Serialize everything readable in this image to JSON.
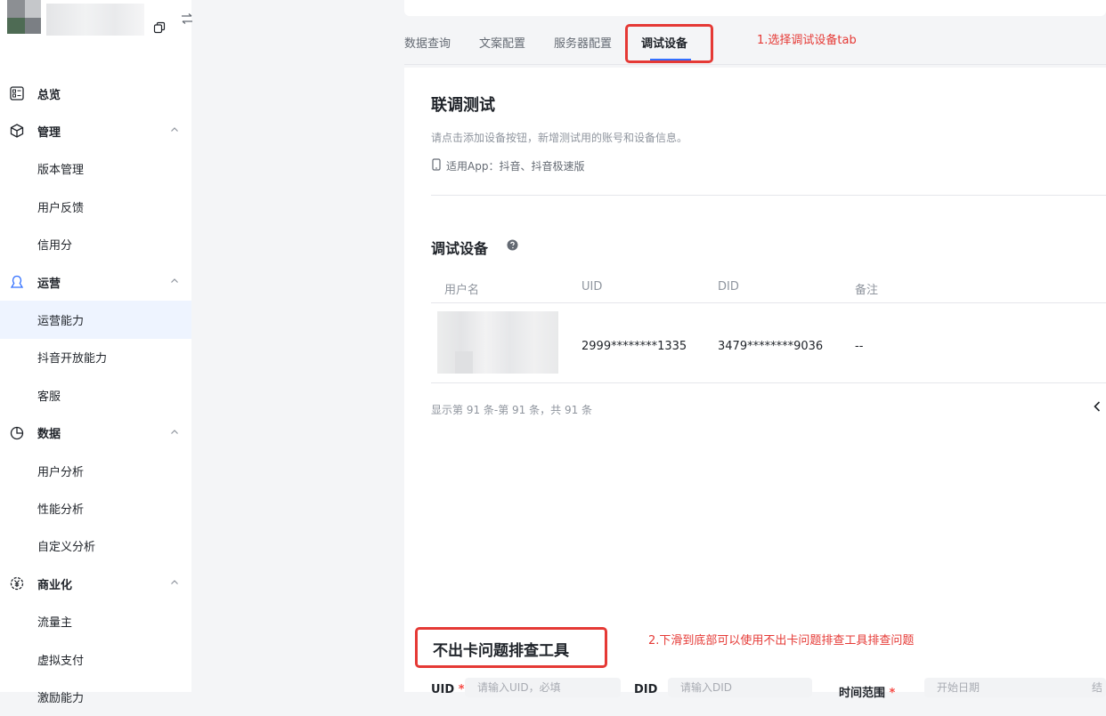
{
  "sidebar": {
    "items": [
      {
        "label": "总览",
        "icon": "dashboard-icon",
        "group": true
      },
      {
        "label": "管理",
        "icon": "cube-icon",
        "group": true,
        "expanded": true
      },
      {
        "label": "版本管理"
      },
      {
        "label": "用户反馈"
      },
      {
        "label": "信用分"
      },
      {
        "label": "运营",
        "icon": "operation-icon",
        "group": true,
        "expanded": true
      },
      {
        "label": "运营能力",
        "active": true
      },
      {
        "label": "抖音开放能力"
      },
      {
        "label": "客服"
      },
      {
        "label": "数据",
        "icon": "pie-chart-icon",
        "group": true,
        "expanded": true
      },
      {
        "label": "用户分析"
      },
      {
        "label": "性能分析"
      },
      {
        "label": "自定义分析"
      },
      {
        "label": "商业化",
        "icon": "yuan-icon",
        "group": true,
        "expanded": true
      },
      {
        "label": "流量主"
      },
      {
        "label": "虚拟支付"
      },
      {
        "label": "激励能力"
      }
    ]
  },
  "tabs": [
    "数据查询",
    "文案配置",
    "服务器配置",
    "调试设备"
  ],
  "annotations": {
    "step1": "1.选择调试设备tab",
    "step2": "2.下滑到底部可以使用不出卡问题排查工具排查问题"
  },
  "section": {
    "title": "联调测试",
    "description": "请点击添加设备按钮，新增测试用的账号和设备信息。",
    "apps": "适用App：抖音、抖音极速版"
  },
  "devices": {
    "title": "调试设备",
    "columns": [
      "用户名",
      "UID",
      "DID",
      "备注"
    ],
    "rows": [
      {
        "uid": "2999********1335",
        "did": "3479********9036",
        "note": "--"
      }
    ],
    "pagination": "显示第 91 条-第 91 条，共 91 条"
  },
  "tool": {
    "title": "不出卡问题排查工具",
    "uid_label": "UID",
    "uid_placeholder": "请输入UID，必填",
    "did_label": "DID",
    "did_placeholder": "请输入DID",
    "time_label": "时间范围",
    "start_placeholder": "开始日期",
    "end_placeholder": "结"
  },
  "colors": {
    "accent": "#3370ff",
    "annotation": "#e53935",
    "active_bg": "#eef4ff"
  }
}
